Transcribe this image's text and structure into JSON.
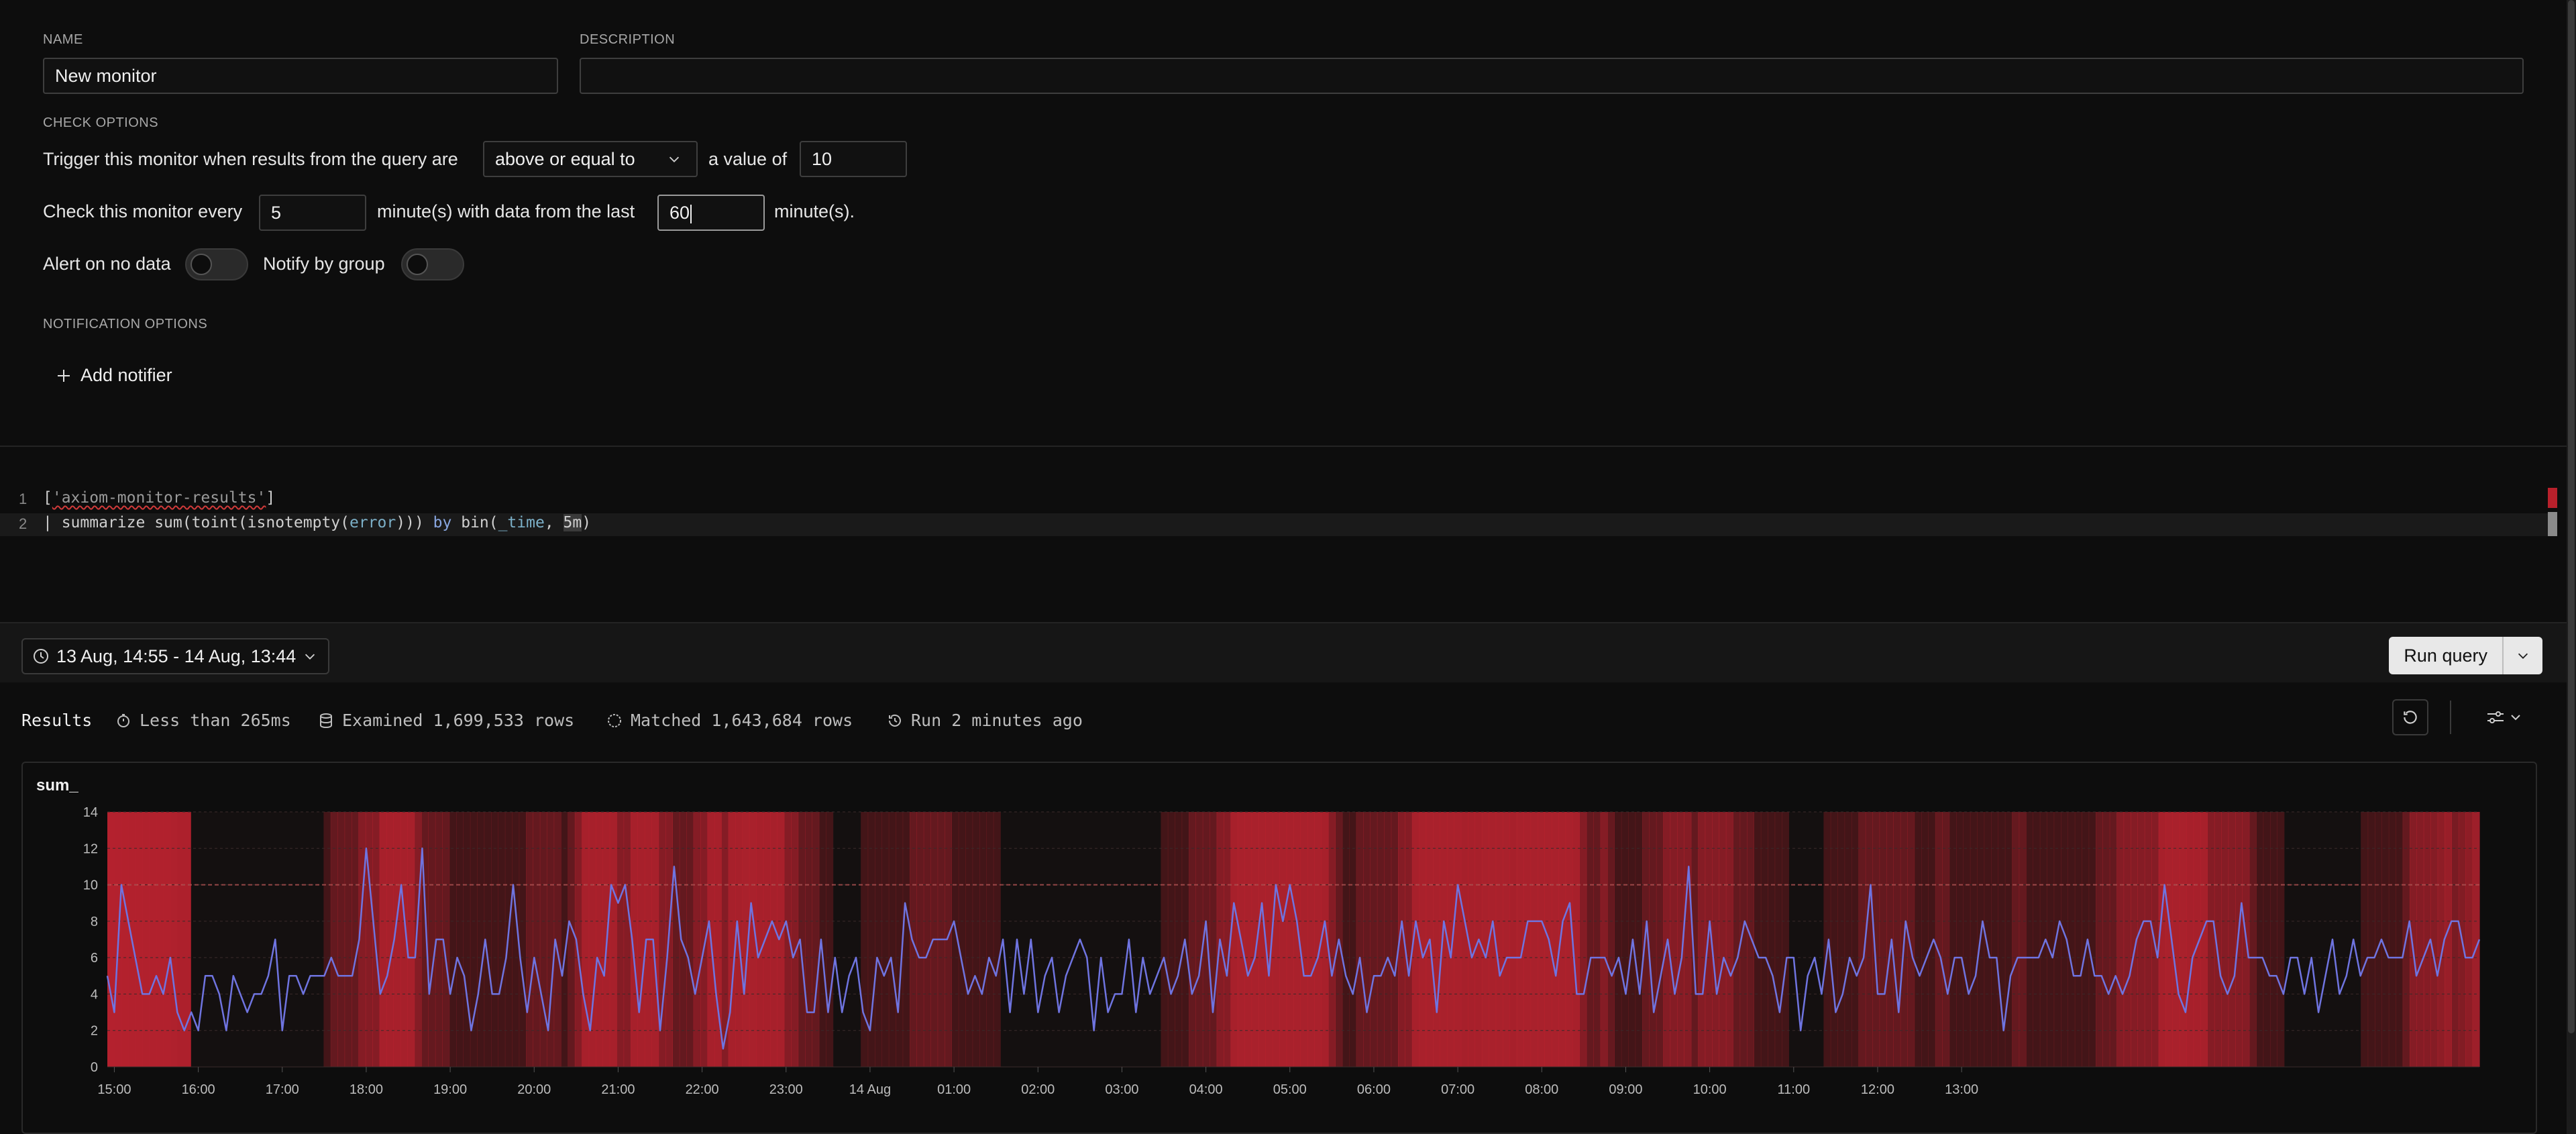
{
  "form": {
    "name_label": "NAME",
    "name_value": "New monitor",
    "description_label": "DESCRIPTION",
    "description_value": "",
    "check_options_label": "CHECK OPTIONS",
    "trigger_prefix": "Trigger this monitor when results from the query are",
    "operator_value": "above or equal to",
    "value_prefix": "a value of",
    "threshold_value": "10",
    "every_prefix": "Check this monitor every",
    "every_value": "5",
    "window_prefix": "minute(s) with data from the last",
    "window_value": "60",
    "window_suffix": "minute(s).",
    "alert_no_data_label": "Alert on no data",
    "alert_no_data_on": false,
    "notify_group_label": "Notify by group",
    "notify_group_on": false,
    "notification_options_label": "NOTIFICATION OPTIONS",
    "add_notifier_label": "Add notifier"
  },
  "editor": {
    "line1_no": "1",
    "line2_no": "2",
    "line1": {
      "open": "[",
      "dataset": "'axiom-monitor-results'",
      "close": "]"
    },
    "line2": {
      "pipe": "| ",
      "op": "summarize",
      "sp1": " ",
      "sum": "sum(",
      "toint": "toint(",
      "isnotempty": "isnotempty(",
      "field": "error",
      "closers": ")))",
      "by": " by ",
      "bin": "bin(",
      "time": "_time",
      "comma": ", ",
      "interval": "5m",
      "end": ")"
    }
  },
  "toolbar": {
    "time_range": "13 Aug, 14:55 - 14 Aug, 13:44",
    "run_label": "Run query"
  },
  "results": {
    "title": "Results",
    "duration": "Less than 265ms",
    "examined": "Examined 1,699,533 rows",
    "matched": "Matched 1,643,684 rows",
    "run_ago": "Run 2 minutes ago"
  },
  "colors": {
    "line": "#6f74e0",
    "alert_fill": "#b5222e",
    "threshold": "#8a2a30"
  },
  "chart_data": {
    "type": "line",
    "title": "sum_",
    "ylim": [
      0,
      14
    ],
    "yticks": [
      0,
      2,
      4,
      6,
      8,
      10,
      12,
      14
    ],
    "xtick_labels": [
      "15:00",
      "16:00",
      "17:00",
      "18:00",
      "19:00",
      "20:00",
      "21:00",
      "22:00",
      "23:00",
      "14 Aug",
      "01:00",
      "02:00",
      "03:00",
      "04:00",
      "05:00",
      "06:00",
      "07:00",
      "08:00",
      "09:00",
      "10:00",
      "11:00",
      "12:00",
      "13:00"
    ],
    "threshold": 10,
    "x_start_hours": 0,
    "step_minutes": 5,
    "series": [
      {
        "values": [
          5,
          3,
          10,
          8,
          6,
          4,
          4,
          5,
          4,
          6,
          3,
          2,
          3,
          2,
          5,
          5,
          4,
          2,
          5,
          4,
          3,
          4,
          4,
          5,
          7,
          2,
          5,
          5,
          4,
          5,
          5,
          5,
          6,
          5,
          5,
          5,
          7,
          12,
          8,
          4,
          5,
          7,
          10,
          6,
          6,
          12,
          4,
          7,
          7,
          4,
          6,
          5,
          2,
          4,
          7,
          4,
          4,
          6,
          10,
          6,
          3,
          6,
          4,
          2,
          7,
          5,
          8,
          7,
          4,
          2,
          6,
          5,
          10,
          9,
          10,
          7,
          3,
          7,
          7,
          2,
          6,
          11,
          7,
          6,
          4,
          6,
          8,
          4,
          1,
          3,
          8,
          4,
          9,
          6,
          7,
          8,
          7,
          8,
          6,
          7,
          3,
          3,
          7,
          3,
          6,
          3,
          5,
          6,
          3,
          2,
          6,
          5,
          6,
          3,
          9,
          7,
          6,
          6,
          7,
          7,
          7,
          8,
          6,
          4,
          5,
          4,
          6,
          5,
          7,
          3,
          7,
          4,
          7,
          3,
          5,
          6,
          3,
          5,
          6,
          7,
          6,
          2,
          6,
          3,
          4,
          4,
          7,
          3,
          6,
          4,
          5,
          6,
          4,
          5,
          7,
          4,
          5,
          8,
          3,
          7,
          5,
          9,
          7,
          5,
          6,
          9,
          5,
          10,
          8,
          10,
          8,
          5,
          5,
          6,
          8,
          5,
          7,
          5,
          4,
          6,
          3,
          5,
          5,
          6,
          5,
          8,
          5,
          8,
          6,
          7,
          3,
          8,
          6,
          10,
          8,
          6,
          7,
          6,
          8,
          5,
          6,
          6,
          6,
          8,
          8,
          8,
          7,
          5,
          8,
          9,
          4,
          4,
          6,
          6,
          6,
          5,
          6,
          4,
          7,
          4,
          8,
          3,
          5,
          7,
          4,
          6,
          11,
          4,
          4,
          8,
          4,
          6,
          5,
          6,
          8,
          7,
          6,
          6,
          5,
          3,
          6,
          6,
          2,
          5,
          6,
          4,
          7,
          3,
          4,
          6,
          5,
          6,
          10,
          4,
          4,
          7,
          3,
          8,
          6,
          5,
          6,
          7,
          6,
          4,
          6,
          6,
          4,
          5,
          8,
          6,
          6,
          2,
          5,
          6,
          6,
          6,
          6,
          7,
          6,
          8,
          7,
          5,
          5,
          7,
          5,
          5,
          4,
          5,
          4,
          5,
          7,
          8,
          8,
          6,
          10,
          7,
          4,
          3,
          6,
          7,
          8,
          8,
          5,
          4,
          5,
          9,
          6,
          6,
          6,
          5,
          5,
          4,
          6,
          6,
          4,
          6,
          3,
          5,
          7,
          4,
          5,
          7,
          5,
          6,
          6,
          7,
          6,
          6,
          6,
          8,
          5,
          6,
          7,
          5,
          7,
          8,
          8,
          6,
          6,
          7
        ]
      }
    ]
  }
}
